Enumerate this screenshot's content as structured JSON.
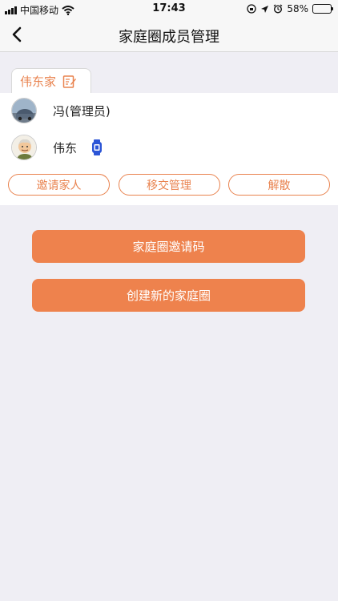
{
  "status_bar": {
    "carrier": "中国移动",
    "time": "17:43",
    "battery": "58%",
    "battery_level": 0.58
  },
  "nav": {
    "title": "家庭圈成员管理",
    "back_icon": "chevron-left-icon"
  },
  "family": {
    "name": "伟东家",
    "edit_icon": "edit-icon"
  },
  "members": [
    {
      "name": "冯(管理员)",
      "avatar": "car-photo-avatar"
    },
    {
      "name": "伟东",
      "avatar": "elderly-man-avatar",
      "device_icon": "smartwatch-icon"
    }
  ],
  "actions": {
    "invite": "邀请家人",
    "transfer": "移交管理",
    "dissolve": "解散"
  },
  "buttons": {
    "invite_code": "家庭圈邀请码",
    "create_new": "创建新的家庭圈"
  },
  "colors": {
    "accent": "#ee824d",
    "background": "#efeef4"
  }
}
